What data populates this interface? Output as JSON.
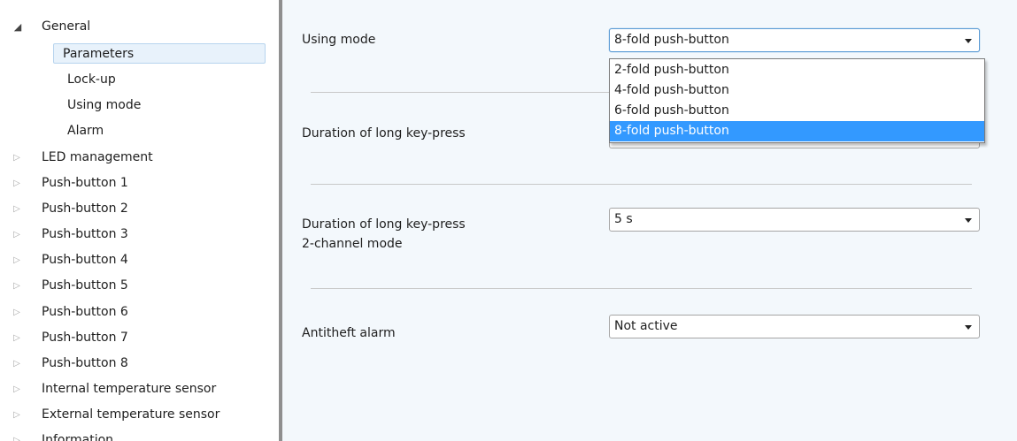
{
  "tree": {
    "items": [
      {
        "label": "General",
        "arrow": "◢"
      },
      {
        "label": "Parameters",
        "arrow": ""
      },
      {
        "label": "Lock-up",
        "arrow": ""
      },
      {
        "label": "Using mode",
        "arrow": ""
      },
      {
        "label": "Alarm",
        "arrow": ""
      },
      {
        "label": "LED management",
        "arrow": "▷"
      },
      {
        "label": "Push-button 1",
        "arrow": "▷"
      },
      {
        "label": "Push-button 2",
        "arrow": "▷"
      },
      {
        "label": "Push-button 3",
        "arrow": "▷"
      },
      {
        "label": "Push-button 4",
        "arrow": "▷"
      },
      {
        "label": "Push-button 5",
        "arrow": "▷"
      },
      {
        "label": "Push-button 6",
        "arrow": "▷"
      },
      {
        "label": "Push-button 7",
        "arrow": "▷"
      },
      {
        "label": "Push-button 8",
        "arrow": "▷"
      },
      {
        "label": "Internal temperature sensor",
        "arrow": "▷"
      },
      {
        "label": "External temperature sensor",
        "arrow": "▷"
      },
      {
        "label": "Information",
        "arrow": "▷"
      }
    ]
  },
  "params": {
    "using_mode": {
      "label": "Using mode",
      "value": "8-fold push-button"
    },
    "long_press": {
      "label": "Duration of long key-press",
      "value": ""
    },
    "long_press_2ch": {
      "label_line1": "Duration of long key-press",
      "label_line2": "2-channel mode",
      "value": "5 s"
    },
    "antitheft": {
      "label": "Antitheft alarm",
      "value": "Not active"
    }
  },
  "dropdown": {
    "options": [
      "2-fold push-button",
      "4-fold push-button",
      "6-fold push-button",
      "8-fold push-button"
    ],
    "selected_index": 3
  },
  "colors": {
    "panel_bg": "#f3f8fc",
    "selection": "#3399ff",
    "tree_selected_bg": "#e8f2fb"
  }
}
